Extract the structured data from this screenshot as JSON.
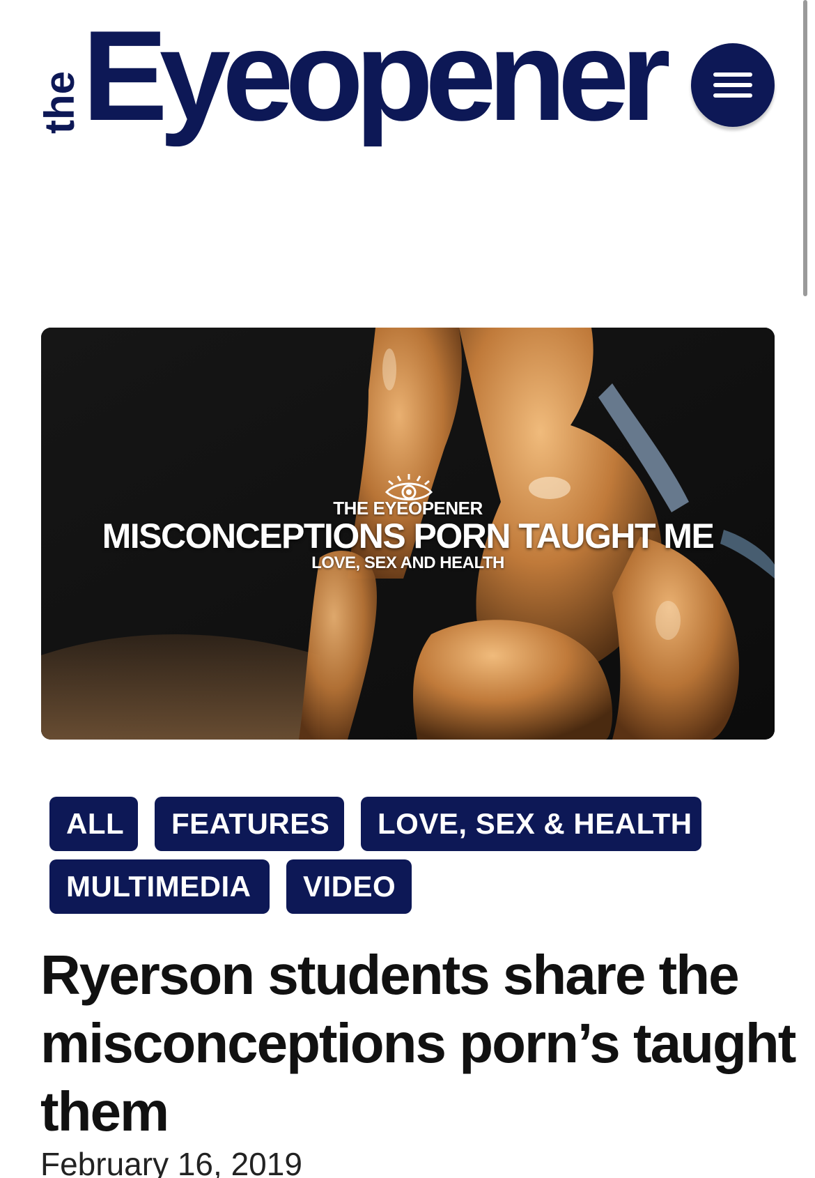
{
  "header": {
    "logo_prefix": "the",
    "logo_name": "Eyeopener",
    "menu_icon": "hamburger-icon",
    "brand_color": "#0d1856"
  },
  "hero": {
    "eye_icon": "eye-icon",
    "brand": "THE EYEOPENER",
    "title": "MISCONCEPTIONS PORN TAUGHT ME",
    "subtitle": "LOVE, SEX AND HEALTH"
  },
  "categories": [
    {
      "label": "ALL"
    },
    {
      "label": "FEATURES"
    },
    {
      "label": "LOVE, SEX & HEALTH"
    },
    {
      "label": "MULTIMEDIA"
    },
    {
      "label": "VIDEO"
    }
  ],
  "article": {
    "headline": "Ryerson students share the misconceptions porn’s taught them",
    "date": "February 16, 2019"
  }
}
